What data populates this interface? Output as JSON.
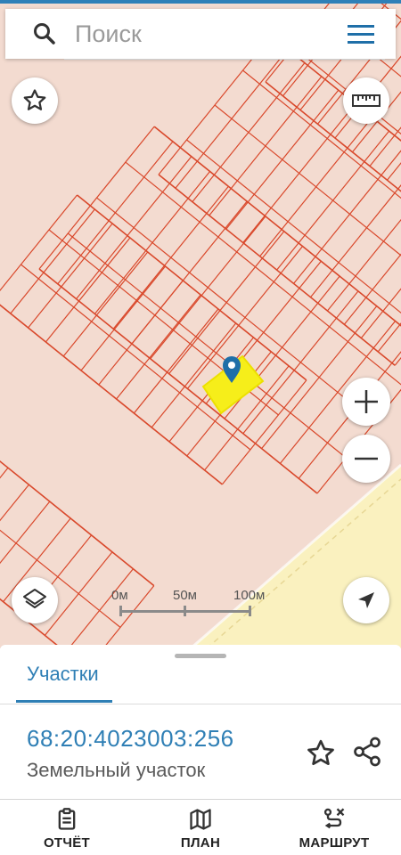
{
  "search": {
    "placeholder": "Поиск"
  },
  "map": {
    "scale_labels": [
      "0м",
      "50м",
      "100м"
    ],
    "colors": {
      "background": "#f3dbd0",
      "parcel_lines": "#d9482b",
      "selected_parcel": "#f6ee1a",
      "marker": "#1f6fa8",
      "road": "#faf1bf"
    }
  },
  "sheet": {
    "tab_label": "Участки",
    "parcel": {
      "cadastral_number": "68:20:4023003:256",
      "type": "Земельный участок"
    }
  },
  "bottom_nav": {
    "report": "ОТЧЁТ",
    "plan": "ПЛАН",
    "route": "МАРШРУТ"
  }
}
